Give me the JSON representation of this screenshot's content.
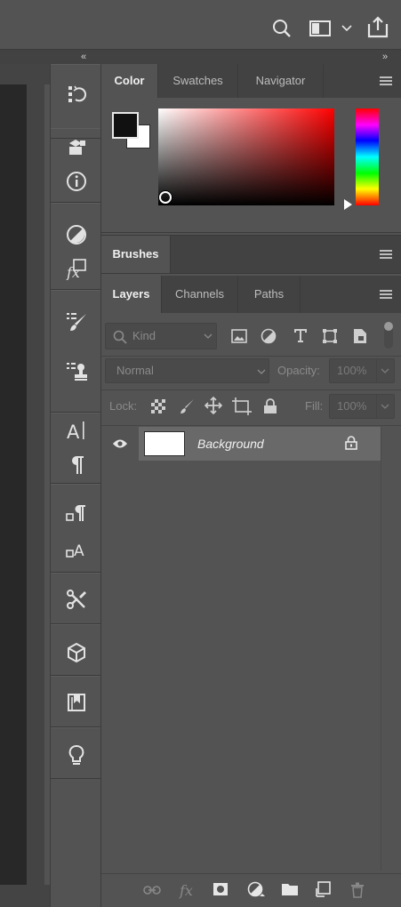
{
  "color_panel": {
    "tabs": [
      "Color",
      "Swatches",
      "Navigator"
    ],
    "active_tab": "Color",
    "foreground_color": "#111111",
    "background_color": "#ffffff",
    "hue_color": "#ff0000"
  },
  "brushes_panel": {
    "tab": "Brushes"
  },
  "layers_panel": {
    "tabs": [
      "Layers",
      "Channels",
      "Paths"
    ],
    "active_tab": "Layers",
    "filter_placeholder": "Kind",
    "blend_mode": "Normal",
    "opacity_label": "Opacity:",
    "opacity_value": "100%",
    "lock_label": "Lock:",
    "fill_label": "Fill:",
    "fill_value": "100%",
    "layers": [
      {
        "name": "Background",
        "visible": true,
        "locked": true
      }
    ]
  },
  "colors": {
    "panel_bg": "#535353",
    "tabbar_bg": "#424242",
    "selected_layer_bg": "#696969"
  }
}
